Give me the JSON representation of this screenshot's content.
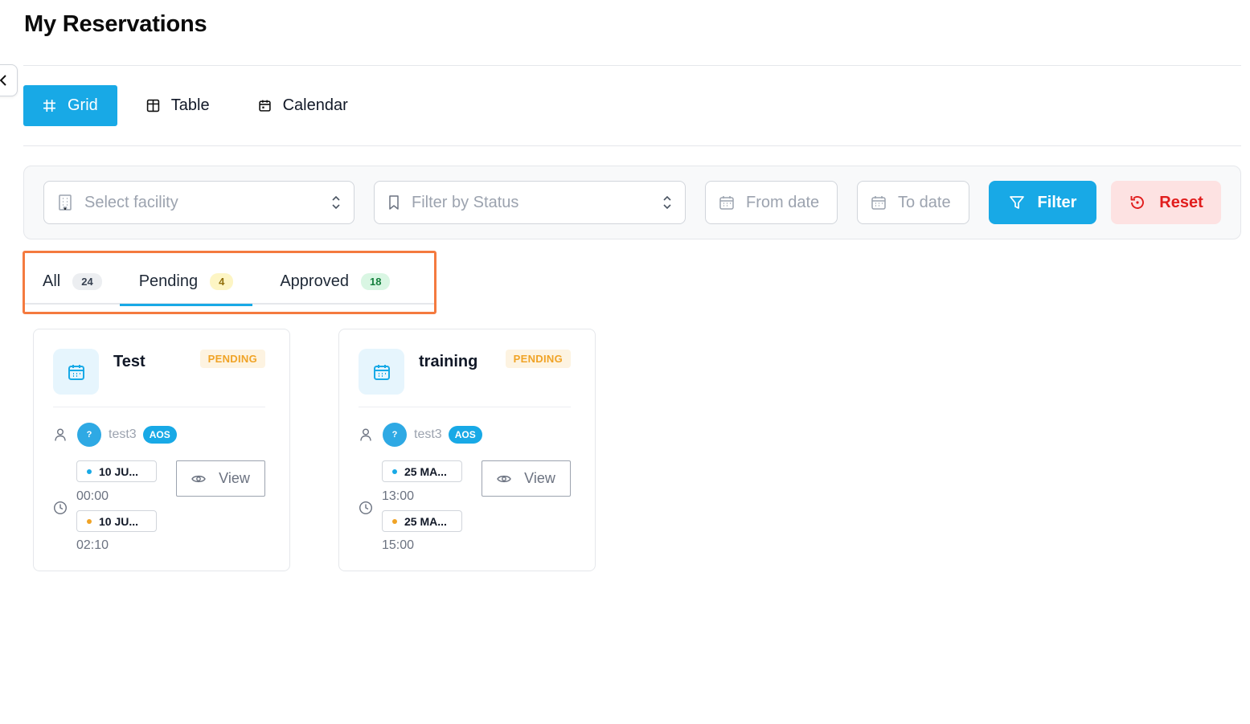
{
  "page": {
    "title": "My Reservations"
  },
  "view_switch": [
    {
      "label": "Grid",
      "active": true,
      "icon": "grid-icon"
    },
    {
      "label": "Table",
      "active": false,
      "icon": "table-icon"
    },
    {
      "label": "Calendar",
      "active": false,
      "icon": "calendar-icon"
    }
  ],
  "filters": {
    "facility_placeholder": "Select facility",
    "status_placeholder": "Filter by Status",
    "from_date_placeholder": "From date",
    "to_date_placeholder": "To date",
    "filter_label": "Filter",
    "reset_label": "Reset"
  },
  "tabs": [
    {
      "label": "All",
      "count": "24",
      "active": false
    },
    {
      "label": "Pending",
      "count": "4",
      "active": true
    },
    {
      "label": "Approved",
      "count": "18",
      "active": false
    }
  ],
  "reservations": [
    {
      "title": "Test",
      "status": "PENDING",
      "avatar": "?",
      "user": "test3",
      "org": "AOS",
      "start_date": "10 JU...",
      "start_time": "00:00",
      "end_date": "10 JU...",
      "end_time": "02:10",
      "view_label": "View"
    },
    {
      "title": "training",
      "status": "PENDING",
      "avatar": "?",
      "user": "test3",
      "org": "AOS",
      "start_date": "25 MA...",
      "start_time": "13:00",
      "end_date": "25 MA...",
      "end_time": "15:00",
      "view_label": "View"
    }
  ],
  "colors": {
    "accent": "#18a9e6",
    "reset_bg": "#fde2e2",
    "reset_text": "#e11d1d",
    "pending": "#f0a326",
    "highlight": "#f47a3f"
  }
}
